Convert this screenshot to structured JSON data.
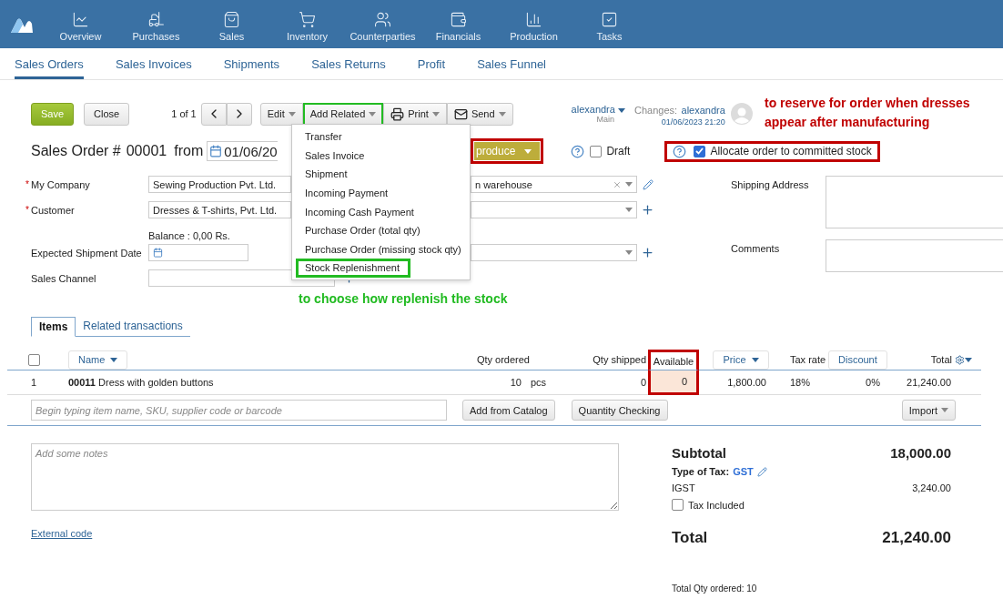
{
  "top_nav": {
    "items": [
      {
        "label": "Overview"
      },
      {
        "label": "Purchases"
      },
      {
        "label": "Sales"
      },
      {
        "label": "Inventory"
      },
      {
        "label": "Counterparties"
      },
      {
        "label": "Financials"
      },
      {
        "label": "Production"
      },
      {
        "label": "Tasks"
      }
    ]
  },
  "sub_nav": {
    "tabs": [
      {
        "label": "Sales Orders",
        "selected": true
      },
      {
        "label": "Sales Invoices",
        "selected": false
      },
      {
        "label": "Shipments",
        "selected": false
      },
      {
        "label": "Sales Returns",
        "selected": false
      },
      {
        "label": "Profit",
        "selected": false
      },
      {
        "label": "Sales Funnel",
        "selected": false
      }
    ]
  },
  "toolbar": {
    "buttons": [
      {
        "label": "Save",
        "kind": "primary"
      },
      {
        "label": "Close",
        "kind": "plain"
      }
    ],
    "pager": "1 of 1",
    "actions": [
      {
        "label": "Edit",
        "kind": "menu"
      },
      {
        "label": "Add Related",
        "kind": "menu",
        "marked": true
      },
      {
        "label": "Print",
        "kind": "print"
      },
      {
        "label": "Send",
        "kind": "send"
      }
    ]
  },
  "owner": {
    "name": "alexandra",
    "group": "Main"
  },
  "changes": {
    "label": "Changes:",
    "user": "alexandra",
    "time": "01/06/2023 21:20"
  },
  "annotation_reserve": {
    "text": "to reserve for order when dresses appear after manufacturing",
    "color": "#c00000"
  },
  "header": {
    "title": "Sales Order #",
    "number": "00001",
    "from": "from",
    "date": "01/06/20",
    "status": {
      "label": "produce",
      "marked": true
    },
    "draft": {
      "label": "Draft",
      "checked": false
    },
    "allocate": {
      "label": "Allocate order to committed stock",
      "checked": true,
      "marked": true
    }
  },
  "add_related_menu": {
    "items": [
      {
        "label": "Transfer"
      },
      {
        "label": "Sales Invoice"
      },
      {
        "label": "Shipment"
      },
      {
        "label": "Incoming Payment"
      },
      {
        "label": "Incoming Cash Payment"
      },
      {
        "label": "Purchase Order (total qty)"
      },
      {
        "label": "Purchase Order (missing stock qty)"
      },
      {
        "label": "Stock Replenishment",
        "marked": true
      }
    ]
  },
  "annotation_replenish": {
    "text": "to choose how replenish the stock",
    "color": "#22bb22"
  },
  "form": {
    "my_company": {
      "required_mark": "*",
      "label": "My Company",
      "value": "Sewing Production Pvt. Ltd."
    },
    "warehouse": {
      "value": "n warehouse"
    },
    "customer": {
      "required_mark": "*",
      "label": "Customer",
      "value": "Dresses & T-shirts, Pvt. Ltd."
    },
    "balance": "Balance : 0,00 Rs.",
    "expected_shipment_date": {
      "label": "Expected Shipment Date"
    },
    "sales_channel": {
      "label": "Sales Channel"
    },
    "shipping_address": {
      "label": "Shipping Address"
    },
    "comments": {
      "label": "Comments"
    }
  },
  "item_tabs": [
    {
      "label": "Items",
      "selected": true
    },
    {
      "label": "Related transactions",
      "selected": false
    }
  ],
  "table": {
    "select_all": {
      "checked": false
    },
    "columns": [
      {
        "label": "Name",
        "kind": "sort"
      },
      {
        "label": "Qty ordered",
        "kind": "text"
      },
      {
        "label": "Qty shipped",
        "kind": "text"
      },
      {
        "label": "Available",
        "kind": "text",
        "marked": true
      },
      {
        "label": "Price",
        "kind": "sort"
      },
      {
        "label": "Tax rate",
        "kind": "text"
      },
      {
        "label": "Discount",
        "kind": "button"
      },
      {
        "label": "Total",
        "kind": "settings"
      }
    ],
    "rows": [
      {
        "number": "1",
        "name": "**00011** Dress with golden buttons",
        "qty": "10",
        "unit": "pcs",
        "shipped": "0",
        "available": "0",
        "shortage": true,
        "price": "1,800.00",
        "tax": "18%",
        "discount": "0%",
        "total": "21,240.00"
      }
    ]
  },
  "add_item": {
    "placeholder": "Begin typing item name, SKU, supplier code or barcode",
    "buttons": [
      {
        "label": "Add from Catalog"
      },
      {
        "label": "Quantity Checking"
      }
    ],
    "import": "Import"
  },
  "notes": {
    "placeholder": "Add some notes"
  },
  "external_code": "External code",
  "totals": {
    "subtotal_label": "Subtotal",
    "subtotal": "18,000.00",
    "tax_type_label": "Type of Tax:",
    "tax_type": "GST",
    "tax_name": "IGST",
    "tax_amount": "3,240.00",
    "tax_included": {
      "label": "Tax Included",
      "checked": false
    },
    "total_label": "Total",
    "total": "21,240.00",
    "qty_summary": "Total Qty ordered: 10"
  }
}
